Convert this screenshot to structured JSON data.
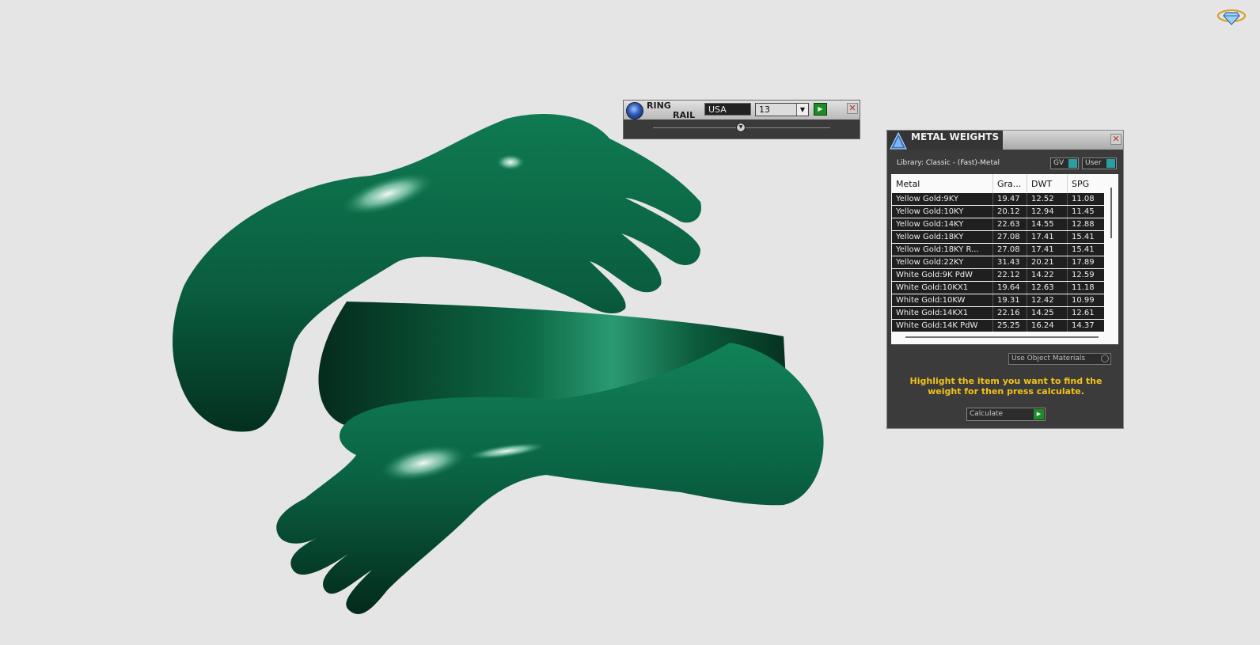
{
  "ring_rail": {
    "title_line1": "RING",
    "title_line2": "RAIL",
    "country": "USA",
    "size": "13",
    "size_chevron": "▼",
    "apply_icon": "▶",
    "close_icon": "✕",
    "slider_icon": "▼"
  },
  "metal_weights": {
    "title": "METAL WEIGHTS",
    "close_icon": "✕",
    "library_label": "Library: Classic - (Fast)-Metal",
    "toggle_gv": "GV",
    "toggle_user": "User",
    "columns": [
      "Metal",
      "Gra...",
      "DWT",
      "SPG"
    ],
    "rows": [
      [
        "Yellow Gold:9KY",
        "19.47",
        "12.52",
        "11.08"
      ],
      [
        "Yellow Gold:10KY",
        "20.12",
        "12.94",
        "11.45"
      ],
      [
        "Yellow Gold:14KY",
        "22.63",
        "14.55",
        "12.88"
      ],
      [
        "Yellow Gold:18KY",
        "27.08",
        "17.41",
        "15.41"
      ],
      [
        "Yellow Gold:18KY R...",
        "27.08",
        "17.41",
        "15.41"
      ],
      [
        "Yellow Gold:22KY",
        "31.43",
        "20.21",
        "17.89"
      ],
      [
        "White Gold:9K PdW",
        "22.12",
        "14.22",
        "12.59"
      ],
      [
        "White Gold:10KX1",
        "19.64",
        "12.63",
        "11.18"
      ],
      [
        "White Gold:10KW",
        "19.31",
        "12.42",
        "10.99"
      ],
      [
        "White Gold:14KX1",
        "22.16",
        "14.25",
        "12.61"
      ],
      [
        "White Gold:14K PdW",
        "25.25",
        "16.24",
        "14.37"
      ]
    ],
    "use_object_materials": "Use Object Materials",
    "message": "Highlight the item you want to find the weight for then press calculate.",
    "calculate_label": "Calculate",
    "calculate_icon": "▶"
  },
  "colors": {
    "background": "#e5e5e5",
    "model_green": "#0b6b45",
    "message_yellow": "#f2c21a",
    "toggle_teal": "#2a9ea0"
  }
}
